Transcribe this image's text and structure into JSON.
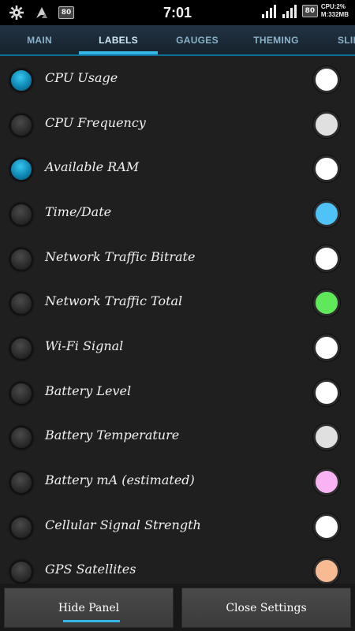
{
  "status_bar": {
    "time": "7:01",
    "badge_left": "80",
    "badge_right": "80",
    "cpu_text": "CPU:2%",
    "mem_text": "M:332MB",
    "icons": [
      "settings-gear-icon",
      "app-logo-icon",
      "signal-icon",
      "signal-icon"
    ]
  },
  "tabs": [
    {
      "label": "MAIN",
      "active": false
    },
    {
      "label": "LABELS",
      "active": true
    },
    {
      "label": "GAUGES",
      "active": false
    },
    {
      "label": "THEMING",
      "active": false
    },
    {
      "label": "SLID",
      "active": false
    }
  ],
  "items": [
    {
      "label": "CPU Usage",
      "enabled": true,
      "color": "#ffffff"
    },
    {
      "label": "CPU Frequency",
      "enabled": false,
      "color": "#e0e0e0"
    },
    {
      "label": "Available RAM",
      "enabled": true,
      "color": "#ffffff"
    },
    {
      "label": "Time/Date",
      "enabled": false,
      "color": "#4fc3f7"
    },
    {
      "label": "Network Traffic Bitrate",
      "enabled": false,
      "color": "#ffffff"
    },
    {
      "label": "Network Traffic Total",
      "enabled": false,
      "color": "#5fe85a"
    },
    {
      "label": "Wi-Fi Signal",
      "enabled": false,
      "color": "#ffffff"
    },
    {
      "label": "Battery Level",
      "enabled": false,
      "color": "#ffffff"
    },
    {
      "label": "Battery Temperature",
      "enabled": false,
      "color": "#e0e0e0"
    },
    {
      "label": "Battery mA (estimated)",
      "enabled": false,
      "color": "#f9b3f3"
    },
    {
      "label": "Cellular Signal Strength",
      "enabled": false,
      "color": "#ffffff"
    },
    {
      "label": "GPS Satellites",
      "enabled": false,
      "color": "#f7ba93"
    }
  ],
  "buttons": {
    "hide_panel": "Hide Panel",
    "close_settings": "Close Settings"
  },
  "colors": {
    "accent": "#33b5e5",
    "led_on": "#0e87b4"
  }
}
